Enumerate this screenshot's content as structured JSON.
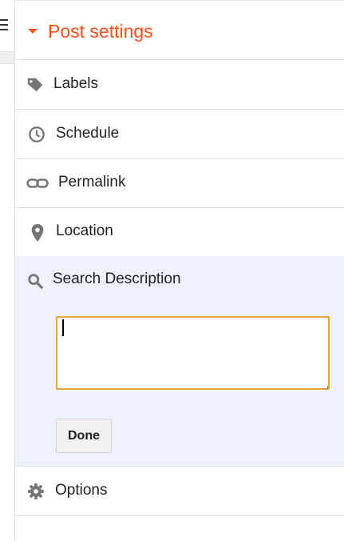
{
  "post_settings": {
    "title": "Post settings",
    "items": [
      {
        "label": "Labels",
        "icon": "tag-icon"
      },
      {
        "label": "Schedule",
        "icon": "clock-icon"
      },
      {
        "label": "Permalink",
        "icon": "link-icon"
      },
      {
        "label": "Location",
        "icon": "location-pin-icon"
      }
    ],
    "search_description": {
      "label": "Search Description",
      "icon": "search-icon",
      "value": "",
      "done_label": "Done"
    },
    "options": {
      "label": "Options",
      "icon": "gear-icon"
    }
  },
  "colors": {
    "accent": "#f4511e",
    "expanded_bg": "#edf2fc",
    "focus_border": "#e8a33c"
  }
}
